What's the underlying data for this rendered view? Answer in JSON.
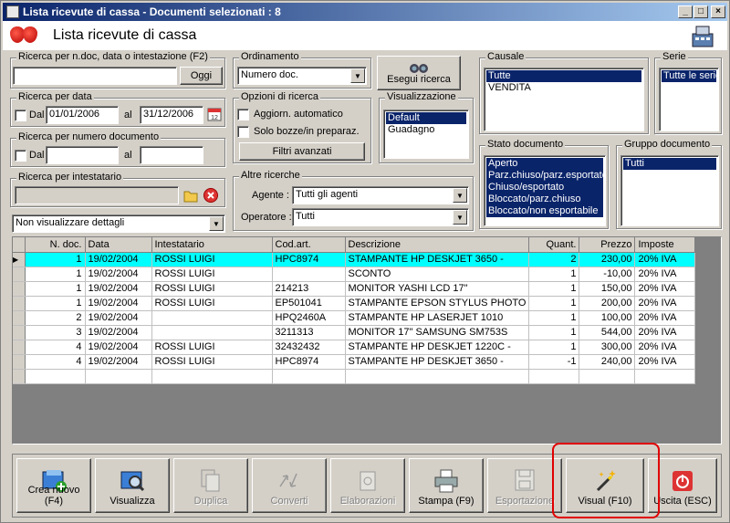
{
  "window": {
    "title": "Lista ricevute di cassa - Documenti selezionati : 8",
    "header": "Lista ricevute di cassa"
  },
  "search_ndoc": {
    "legend": "Ricerca per n.doc, data o intestazione (F2)",
    "value": "",
    "button": "Oggi"
  },
  "search_date": {
    "legend": "Ricerca per data",
    "dal_label": "Dal",
    "from": "01/01/2006",
    "al_label": "al",
    "to": "31/12/2006"
  },
  "search_number": {
    "legend": "Ricerca per numero documento",
    "dal_label": "Dal",
    "from": "",
    "al_label": "al",
    "to": ""
  },
  "search_holder": {
    "legend": "Ricerca per intestatario",
    "value": ""
  },
  "details_combo": "Non visualizzare dettagli",
  "ordering": {
    "legend": "Ordinamento",
    "value": "Numero doc."
  },
  "search_button": "Esegui ricerca",
  "options": {
    "legend": "Opzioni di ricerca",
    "auto_update": "Aggiorn. automatico",
    "drafts_only": "Solo bozze/in preparaz.",
    "advanced_filters": "Filtri avanzati"
  },
  "view": {
    "legend": "Visualizzazione",
    "items": [
      "Default",
      "Guadagno"
    ],
    "selected": 0
  },
  "other": {
    "legend": "Altre ricerche",
    "agent_label": "Agente :",
    "agent_value": "Tutti gli agenti",
    "operator_label": "Operatore :",
    "operator_value": "Tutti"
  },
  "causale": {
    "legend": "Causale",
    "items": [
      "Tutte",
      "VENDITA"
    ],
    "selected": 0
  },
  "serie": {
    "legend": "Serie",
    "items": [
      "Tutte le serie"
    ],
    "selected": 0
  },
  "stato": {
    "legend": "Stato documento",
    "items": [
      "Aperto",
      "Parz.chiuso/parz.esportato",
      "Chiuso/esportato",
      "Bloccato/parz.chiuso",
      "Bloccato/non esportabile"
    ]
  },
  "gruppo": {
    "legend": "Gruppo documento",
    "items": [
      "Tutti"
    ]
  },
  "table": {
    "headers": [
      "N. doc.",
      "Data",
      "Intestatario",
      "Cod.art.",
      "Descrizione",
      "Quant.",
      "Prezzo",
      "Imposte"
    ],
    "rows": [
      [
        "1",
        "19/02/2004",
        "ROSSI LUIGI",
        "HPC8974",
        "STAMPANTE HP DESKJET 3650 -",
        "2",
        "230,00",
        "20% IVA"
      ],
      [
        "1",
        "19/02/2004",
        "ROSSI LUIGI",
        "",
        "SCONTO",
        "1",
        "-10,00",
        "20% IVA"
      ],
      [
        "1",
        "19/02/2004",
        "ROSSI LUIGI",
        "214213",
        "MONITOR YASHI LCD 17\"",
        "1",
        "150,00",
        "20% IVA"
      ],
      [
        "1",
        "19/02/2004",
        "ROSSI LUIGI",
        "EP501041",
        "STAMPANTE EPSON STYLUS PHOTO",
        "1",
        "200,00",
        "20% IVA"
      ],
      [
        "2",
        "19/02/2004",
        "",
        "HPQ2460A",
        "STAMPANTE HP LASERJET 1010",
        "1",
        "100,00",
        "20% IVA"
      ],
      [
        "3",
        "19/02/2004",
        "",
        "3211313",
        "MONITOR 17\" SAMSUNG SM753S",
        "1",
        "544,00",
        "20% IVA"
      ],
      [
        "4",
        "19/02/2004",
        "ROSSI LUIGI",
        "32432432",
        "STAMPANTE HP DESKJET 1220C -",
        "1",
        "300,00",
        "20% IVA"
      ],
      [
        "4",
        "19/02/2004",
        "ROSSI LUIGI",
        "HPC8974",
        "STAMPANTE HP DESKJET 3650 -",
        "-1",
        "240,00",
        "20% IVA"
      ]
    ]
  },
  "toolbar": {
    "new": "Crea nuovo (F4)",
    "view": "Visualizza",
    "duplicate": "Duplica",
    "convert": "Converti",
    "process": "Elaborazioni",
    "print": "Stampa (F9)",
    "export": "Esportazione",
    "visual": "Visual (F10)",
    "exit": "Uscita (ESC)"
  },
  "colors": {
    "highlight_row": "#00ffff",
    "selection": "#0a246a",
    "annotation": "#e00000"
  }
}
